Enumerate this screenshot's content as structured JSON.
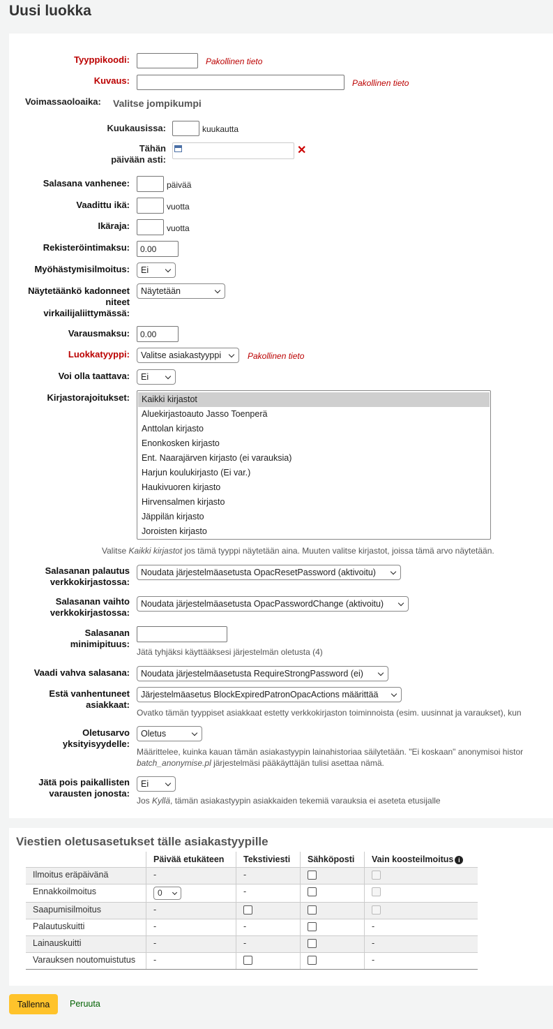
{
  "page_title": "Uusi luokka",
  "required_note": "Pakollinen tieto",
  "form": {
    "typecode_label": "Tyyppikoodi:",
    "description_label": "Kuvaus:",
    "validity_label": "Voimassaoloaika:",
    "validity_choose": "Valitse jompikumpi",
    "months_label": "Kuukausissa:",
    "months_unit": "kuukautta",
    "until_label_1": "Tähän",
    "until_label_2": "päivään asti:",
    "pw_expiry_label": "Salasana vanhenee:",
    "pw_expiry_unit": "päivää",
    "age_req_label": "Vaadittu ikä:",
    "age_req_unit": "vuotta",
    "age_limit_label": "Ikäraja:",
    "age_limit_unit": "vuotta",
    "enrol_fee_label": "Rekisteröintimaksu:",
    "enrol_fee_value": "0.00",
    "overdue_label": "Myöhästymisilmoitus:",
    "overdue_value": "Ei",
    "lost_label_1": "Näytetäänkö kadonneet",
    "lost_label_2": "niteet",
    "lost_label_3": "virkailijaliittymässä:",
    "lost_value": "Näytetään",
    "hold_fee_label": "Varausmaksu:",
    "hold_fee_value": "0.00",
    "category_type_label": "Luokkatyyppi:",
    "category_type_value": "Valitse asiakastyyppi",
    "guarantor_label": "Voi olla taattava:",
    "guarantor_value": "Ei",
    "library_limits_label": "Kirjastorajoitukset:",
    "library_options": [
      "Kaikki kirjastot",
      "Aluekirjastoauto Jasso Toenperä",
      "Anttolan kirjasto",
      "Enonkosken kirjasto",
      "Ent. Naarajärven kirjasto (ei varauksia)",
      "Harjun koulukirjasto (Ei var.)",
      "Haukivuoren kirjasto",
      "Hirvensalmen kirjasto",
      "Jäppilän kirjasto",
      "Joroisten kirjasto"
    ],
    "library_hint_pre": "Valitse ",
    "library_hint_em": "Kaikki kirjastot",
    "library_hint_post": " jos tämä tyyppi näytetään aina. Muuten valitse kirjastot, joissa tämä arvo näytetään.",
    "pw_reset_label_1": "Salasanan palautus",
    "pw_reset_label_2": "verkkokirjastossa:",
    "pw_reset_value": "Noudata järjestelmäasetusta OpacResetPassword (aktivoitu)",
    "pw_change_label_1": "Salasanan vaihto",
    "pw_change_label_2": "verkkokirjastossa:",
    "pw_change_value": "Noudata järjestelmäasetusta OpacPasswordChange (aktivoitu)",
    "pw_min_label_1": "Salasanan",
    "pw_min_label_2": "minimipituus:",
    "pw_min_hint": "Jätä tyhjäksi käyttääksesi järjestelmän oletusta (4)",
    "strong_pw_label": "Vaadi vahva salasana:",
    "strong_pw_value": "Noudata järjestelmäasetusta RequireStrongPassword (ei)",
    "block_expired_label_1": "Estä vanhentuneet",
    "block_expired_label_2": "asiakkaat:",
    "block_expired_value": "Järjestelmäasetus BlockExpiredPatronOpacActions määrittää",
    "block_expired_hint": "Ovatko tämän tyyppiset asiakkaat estetty verkkokirjaston toiminnoista (esim. uusinnat ja varaukset), kun",
    "privacy_label_1": "Oletusarvo",
    "privacy_label_2": "yksityisyydelle:",
    "privacy_value": "Oletus",
    "privacy_hint_1": "Määrittelee, kuinka kauan tämän asiakastyypin lainahistoriaa säilytetään. \"Ei koskaan\" anonymisoi histor",
    "privacy_hint_2_em": "batch_anonymise.pl",
    "privacy_hint_2_post": " järjestelmäsi pääkäyttäjän tulisi asettaa nämä.",
    "local_holds_label_1": "Jätä pois paikallisten",
    "local_holds_label_2": "varausten jonosta:",
    "local_holds_value": "Ei",
    "local_holds_hint_pre": "Jos ",
    "local_holds_hint_em": "Kyllä",
    "local_holds_hint_post": ", tämän asiakastyypin asiakkaiden tekemiä varauksia ei aseteta etusijalle"
  },
  "messaging": {
    "title": "Viestien oletusasetukset tälle asiakastyypille",
    "headers": [
      "",
      "Päivää etukäteen",
      "Tekstiviesti",
      "Sähköposti",
      "Vain koosteilmoitus"
    ],
    "rows": [
      {
        "name": "Ilmoitus eräpäivänä",
        "days": "-",
        "sms": "-",
        "email": "checkbox",
        "digest": "disabled"
      },
      {
        "name": "Ennakkoilmoitus",
        "days": "0",
        "sms": "-",
        "email": "checkbox",
        "digest": "disabled"
      },
      {
        "name": "Saapumisilmoitus",
        "days": "-",
        "sms": "checkbox",
        "email": "checkbox",
        "digest": "disabled"
      },
      {
        "name": "Palautuskuitti",
        "days": "-",
        "sms": "-",
        "email": "checkbox",
        "digest": "-"
      },
      {
        "name": "Lainauskuitti",
        "days": "-",
        "sms": "-",
        "email": "checkbox",
        "digest": "-"
      },
      {
        "name": "Varauksen noutomuistutus",
        "days": "-",
        "sms": "checkbox",
        "email": "checkbox",
        "digest": "-"
      }
    ]
  },
  "actions": {
    "save": "Tallenna",
    "cancel": "Peruuta"
  }
}
